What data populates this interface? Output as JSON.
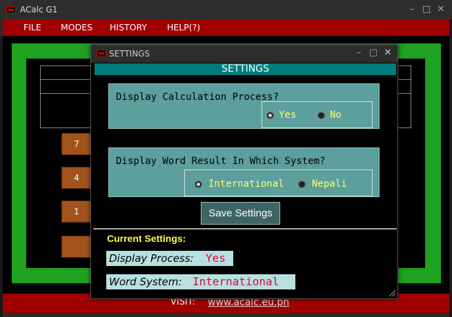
{
  "window": {
    "title": "ACalc G1"
  },
  "menu": {
    "items": [
      "FILE",
      "MODES",
      "HISTORY",
      "HELP(?)"
    ]
  },
  "calculator": {
    "keys": [
      "7",
      "4",
      "1",
      ""
    ]
  },
  "footer": {
    "visit_label": "VISIT:",
    "link": "www.acalc.eu.pn"
  },
  "dialog": {
    "title": "SETTINGS",
    "header": "SETTINGS",
    "process": {
      "question": "Display Calculation Process?",
      "options": [
        "Yes",
        "No"
      ],
      "selected": "Yes"
    },
    "word_system": {
      "question": "Display Word Result In Which System?",
      "options": [
        "International",
        "Nepali"
      ],
      "selected": "International"
    },
    "save_label": "Save Settings",
    "current": {
      "title": "Current Settings:",
      "process_label": "Display Process:",
      "process_value": "Yes",
      "word_label": "Word System:",
      "word_value": "International"
    }
  },
  "colors": {
    "menu_red": "#a00000",
    "frame_green": "#1fa21f",
    "teal_header": "#007c7c",
    "group_teal": "#5c9f9c",
    "radio_text": "#ffff70",
    "current_title": "#ffff40",
    "value_red": "#d40f3d"
  },
  "icons": [
    "app-icon",
    "minimize-icon",
    "maximize-icon",
    "close-icon",
    "resize-grip-icon"
  ]
}
